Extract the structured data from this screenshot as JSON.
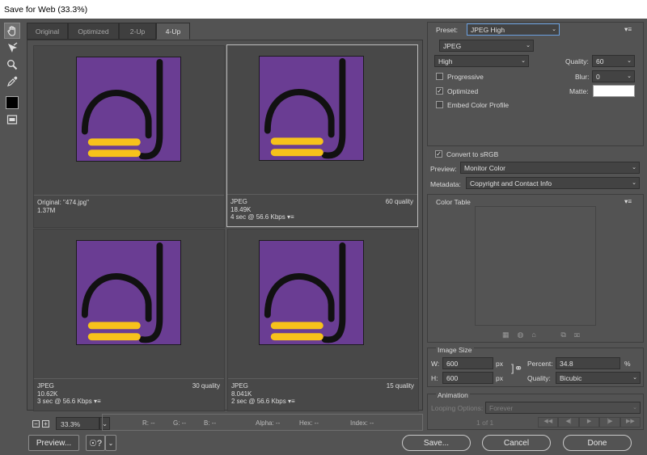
{
  "window": {
    "title": "Save for Web (33.3%)"
  },
  "tools": [
    {
      "name": "hand-tool-icon"
    },
    {
      "name": "slice-select-tool-icon"
    },
    {
      "name": "zoom-tool-icon"
    },
    {
      "name": "eyedropper-tool-icon"
    },
    {
      "name": "eyedropper-color-swatch"
    },
    {
      "name": "toggle-slices-icon"
    }
  ],
  "tabs": [
    {
      "label": "Original"
    },
    {
      "label": "Optimized"
    },
    {
      "label": "2-Up"
    },
    {
      "label": "4-Up",
      "active": true
    }
  ],
  "panes": [
    {
      "line1": "Original: \"474.jpg\"",
      "line2": "1.37M",
      "line3": "",
      "quality": ""
    },
    {
      "line1": "JPEG",
      "line2": "18.49K",
      "line3": "4 sec @ 56.6 Kbps",
      "quality": "60 quality",
      "selected": true
    },
    {
      "line1": "JPEG",
      "line2": "10.62K",
      "line3": "3 sec @ 56.6 Kbps",
      "quality": "30 quality"
    },
    {
      "line1": "JPEG",
      "line2": "8.041K",
      "line3": "2 sec @ 56.6 Kbps",
      "quality": "15 quality"
    }
  ],
  "image_colors": {
    "background": "#6a3d93",
    "stroke": "#111111",
    "bars": "#f7c21b"
  },
  "bottom": {
    "zoom_out": "−",
    "zoom_in": "+",
    "zoom": "33.3%",
    "r": "R: --",
    "g": "G: --",
    "b": "B: --",
    "alpha": "Alpha: --",
    "hex": "Hex: --",
    "index": "Index: --"
  },
  "buttons": {
    "preview": "Preview...",
    "save": "Save...",
    "cancel": "Cancel",
    "done": "Done"
  },
  "settings": {
    "preset_label": "Preset:",
    "preset": "JPEG High",
    "format": "JPEG",
    "quality_level": "High",
    "progressive_label": "Progressive",
    "progressive": false,
    "optimized_label": "Optimized",
    "optimized": true,
    "embed_label": "Embed Color Profile",
    "embed": false,
    "quality_label": "Quality:",
    "quality": "60",
    "blur_label": "Blur:",
    "blur": "0",
    "matte_label": "Matte:",
    "srgb_label": "Convert to sRGB",
    "srgb": true,
    "preview_label": "Preview:",
    "preview_value": "Monitor Color",
    "metadata_label": "Metadata:",
    "metadata_value": "Copyright and Contact Info"
  },
  "color_table": {
    "title": "Color Table"
  },
  "image_size": {
    "title": "Image Size",
    "w_label": "W:",
    "w": "600",
    "h_label": "H:",
    "h": "600",
    "unit": "px",
    "percent_label": "Percent:",
    "percent": "34.8",
    "percent_unit": "%",
    "quality_label": "Quality:",
    "quality": "Bicubic"
  },
  "animation": {
    "title": "Animation",
    "looping_label": "Looping Options:",
    "looping": "Forever",
    "frame": "1 of 1"
  }
}
